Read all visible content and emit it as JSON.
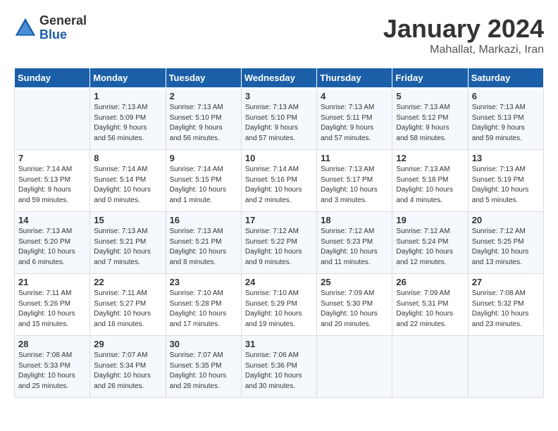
{
  "logo": {
    "general": "General",
    "blue": "Blue"
  },
  "header": {
    "title": "January 2024",
    "subtitle": "Mahallat, Markazi, Iran"
  },
  "weekdays": [
    "Sunday",
    "Monday",
    "Tuesday",
    "Wednesday",
    "Thursday",
    "Friday",
    "Saturday"
  ],
  "weeks": [
    [
      {
        "day": "",
        "info": ""
      },
      {
        "day": "1",
        "info": "Sunrise: 7:13 AM\nSunset: 5:09 PM\nDaylight: 9 hours\nand 56 minutes."
      },
      {
        "day": "2",
        "info": "Sunrise: 7:13 AM\nSunset: 5:10 PM\nDaylight: 9 hours\nand 56 minutes."
      },
      {
        "day": "3",
        "info": "Sunrise: 7:13 AM\nSunset: 5:10 PM\nDaylight: 9 hours\nand 57 minutes."
      },
      {
        "day": "4",
        "info": "Sunrise: 7:13 AM\nSunset: 5:11 PM\nDaylight: 9 hours\nand 57 minutes."
      },
      {
        "day": "5",
        "info": "Sunrise: 7:13 AM\nSunset: 5:12 PM\nDaylight: 9 hours\nand 58 minutes."
      },
      {
        "day": "6",
        "info": "Sunrise: 7:13 AM\nSunset: 5:13 PM\nDaylight: 9 hours\nand 59 minutes."
      }
    ],
    [
      {
        "day": "7",
        "info": "Sunrise: 7:14 AM\nSunset: 5:13 PM\nDaylight: 9 hours\nand 59 minutes."
      },
      {
        "day": "8",
        "info": "Sunrise: 7:14 AM\nSunset: 5:14 PM\nDaylight: 10 hours\nand 0 minutes."
      },
      {
        "day": "9",
        "info": "Sunrise: 7:14 AM\nSunset: 5:15 PM\nDaylight: 10 hours\nand 1 minute."
      },
      {
        "day": "10",
        "info": "Sunrise: 7:14 AM\nSunset: 5:16 PM\nDaylight: 10 hours\nand 2 minutes."
      },
      {
        "day": "11",
        "info": "Sunrise: 7:13 AM\nSunset: 5:17 PM\nDaylight: 10 hours\nand 3 minutes."
      },
      {
        "day": "12",
        "info": "Sunrise: 7:13 AM\nSunset: 5:18 PM\nDaylight: 10 hours\nand 4 minutes."
      },
      {
        "day": "13",
        "info": "Sunrise: 7:13 AM\nSunset: 5:19 PM\nDaylight: 10 hours\nand 5 minutes."
      }
    ],
    [
      {
        "day": "14",
        "info": "Sunrise: 7:13 AM\nSunset: 5:20 PM\nDaylight: 10 hours\nand 6 minutes."
      },
      {
        "day": "15",
        "info": "Sunrise: 7:13 AM\nSunset: 5:21 PM\nDaylight: 10 hours\nand 7 minutes."
      },
      {
        "day": "16",
        "info": "Sunrise: 7:13 AM\nSunset: 5:21 PM\nDaylight: 10 hours\nand 8 minutes."
      },
      {
        "day": "17",
        "info": "Sunrise: 7:12 AM\nSunset: 5:22 PM\nDaylight: 10 hours\nand 9 minutes."
      },
      {
        "day": "18",
        "info": "Sunrise: 7:12 AM\nSunset: 5:23 PM\nDaylight: 10 hours\nand 11 minutes."
      },
      {
        "day": "19",
        "info": "Sunrise: 7:12 AM\nSunset: 5:24 PM\nDaylight: 10 hours\nand 12 minutes."
      },
      {
        "day": "20",
        "info": "Sunrise: 7:12 AM\nSunset: 5:25 PM\nDaylight: 10 hours\nand 13 minutes."
      }
    ],
    [
      {
        "day": "21",
        "info": "Sunrise: 7:11 AM\nSunset: 5:26 PM\nDaylight: 10 hours\nand 15 minutes."
      },
      {
        "day": "22",
        "info": "Sunrise: 7:11 AM\nSunset: 5:27 PM\nDaylight: 10 hours\nand 16 minutes."
      },
      {
        "day": "23",
        "info": "Sunrise: 7:10 AM\nSunset: 5:28 PM\nDaylight: 10 hours\nand 17 minutes."
      },
      {
        "day": "24",
        "info": "Sunrise: 7:10 AM\nSunset: 5:29 PM\nDaylight: 10 hours\nand 19 minutes."
      },
      {
        "day": "25",
        "info": "Sunrise: 7:09 AM\nSunset: 5:30 PM\nDaylight: 10 hours\nand 20 minutes."
      },
      {
        "day": "26",
        "info": "Sunrise: 7:09 AM\nSunset: 5:31 PM\nDaylight: 10 hours\nand 22 minutes."
      },
      {
        "day": "27",
        "info": "Sunrise: 7:08 AM\nSunset: 5:32 PM\nDaylight: 10 hours\nand 23 minutes."
      }
    ],
    [
      {
        "day": "28",
        "info": "Sunrise: 7:08 AM\nSunset: 5:33 PM\nDaylight: 10 hours\nand 25 minutes."
      },
      {
        "day": "29",
        "info": "Sunrise: 7:07 AM\nSunset: 5:34 PM\nDaylight: 10 hours\nand 26 minutes."
      },
      {
        "day": "30",
        "info": "Sunrise: 7:07 AM\nSunset: 5:35 PM\nDaylight: 10 hours\nand 28 minutes."
      },
      {
        "day": "31",
        "info": "Sunrise: 7:06 AM\nSunset: 5:36 PM\nDaylight: 10 hours\nand 30 minutes."
      },
      {
        "day": "",
        "info": ""
      },
      {
        "day": "",
        "info": ""
      },
      {
        "day": "",
        "info": ""
      }
    ]
  ]
}
